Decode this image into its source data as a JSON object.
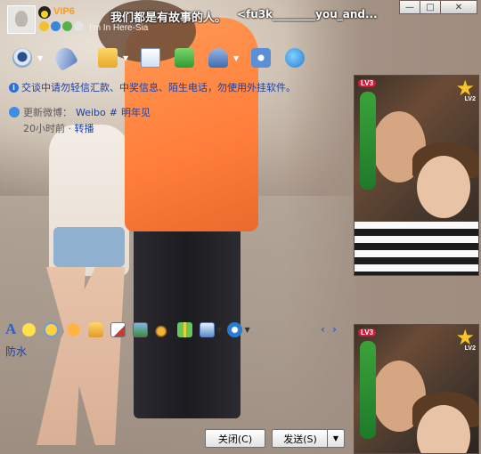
{
  "titlebar": {
    "vip_badge": "VIP6",
    "nickname": "我们都是有故事的人。",
    "alias": "<fu3k________you_and...",
    "signature": "I'm In Here-Sia",
    "window_buttons": {
      "minimize": "—",
      "maximize": "□",
      "close": "✕"
    }
  },
  "toolbar": {
    "icons": [
      "webcam-icon",
      "microphone-icon",
      "folder-icon",
      "mail-icon",
      "add-app-icon",
      "user-card-icon",
      "settings-icon",
      "share-icon"
    ]
  },
  "notice": {
    "text": "交谈中请勿轻信汇款、中奖信息、陌生电话，勿使用外挂软件。"
  },
  "weibo": {
    "update_label": "更新微博：",
    "user": "Weibo",
    "hash": "#",
    "content": "明年见",
    "time": "20小时前",
    "forward": "转播"
  },
  "photos": {
    "top": {
      "level": "LV3",
      "star_level": "LV2"
    },
    "bottom": {
      "level": "LV3",
      "star_level": "LV2"
    }
  },
  "formatbar": {
    "font_label": "A",
    "fangshui": "防水"
  },
  "buttons": {
    "close": "关闭(C)",
    "send": "发送(S)",
    "send_arrow": "▼"
  },
  "colors": {
    "link_blue": "#1d3fa0",
    "vip_orange": "#ff9a1b",
    "shirt_orange": "#ff7e3b"
  }
}
